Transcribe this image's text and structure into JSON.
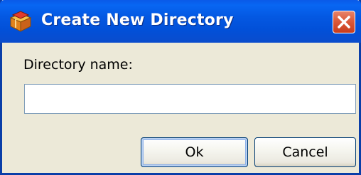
{
  "window": {
    "title": "Create New Directory",
    "app_icon": "package-box-icon",
    "close_icon": "close-x-icon"
  },
  "form": {
    "directory_label": "Directory name:",
    "directory_value": "",
    "directory_placeholder": ""
  },
  "buttons": {
    "ok_label": "Ok",
    "cancel_label": "Cancel"
  },
  "colors": {
    "titlebar": "#0458e2",
    "close_button": "#db5a3a",
    "dialog_background": "#ece9d8"
  }
}
